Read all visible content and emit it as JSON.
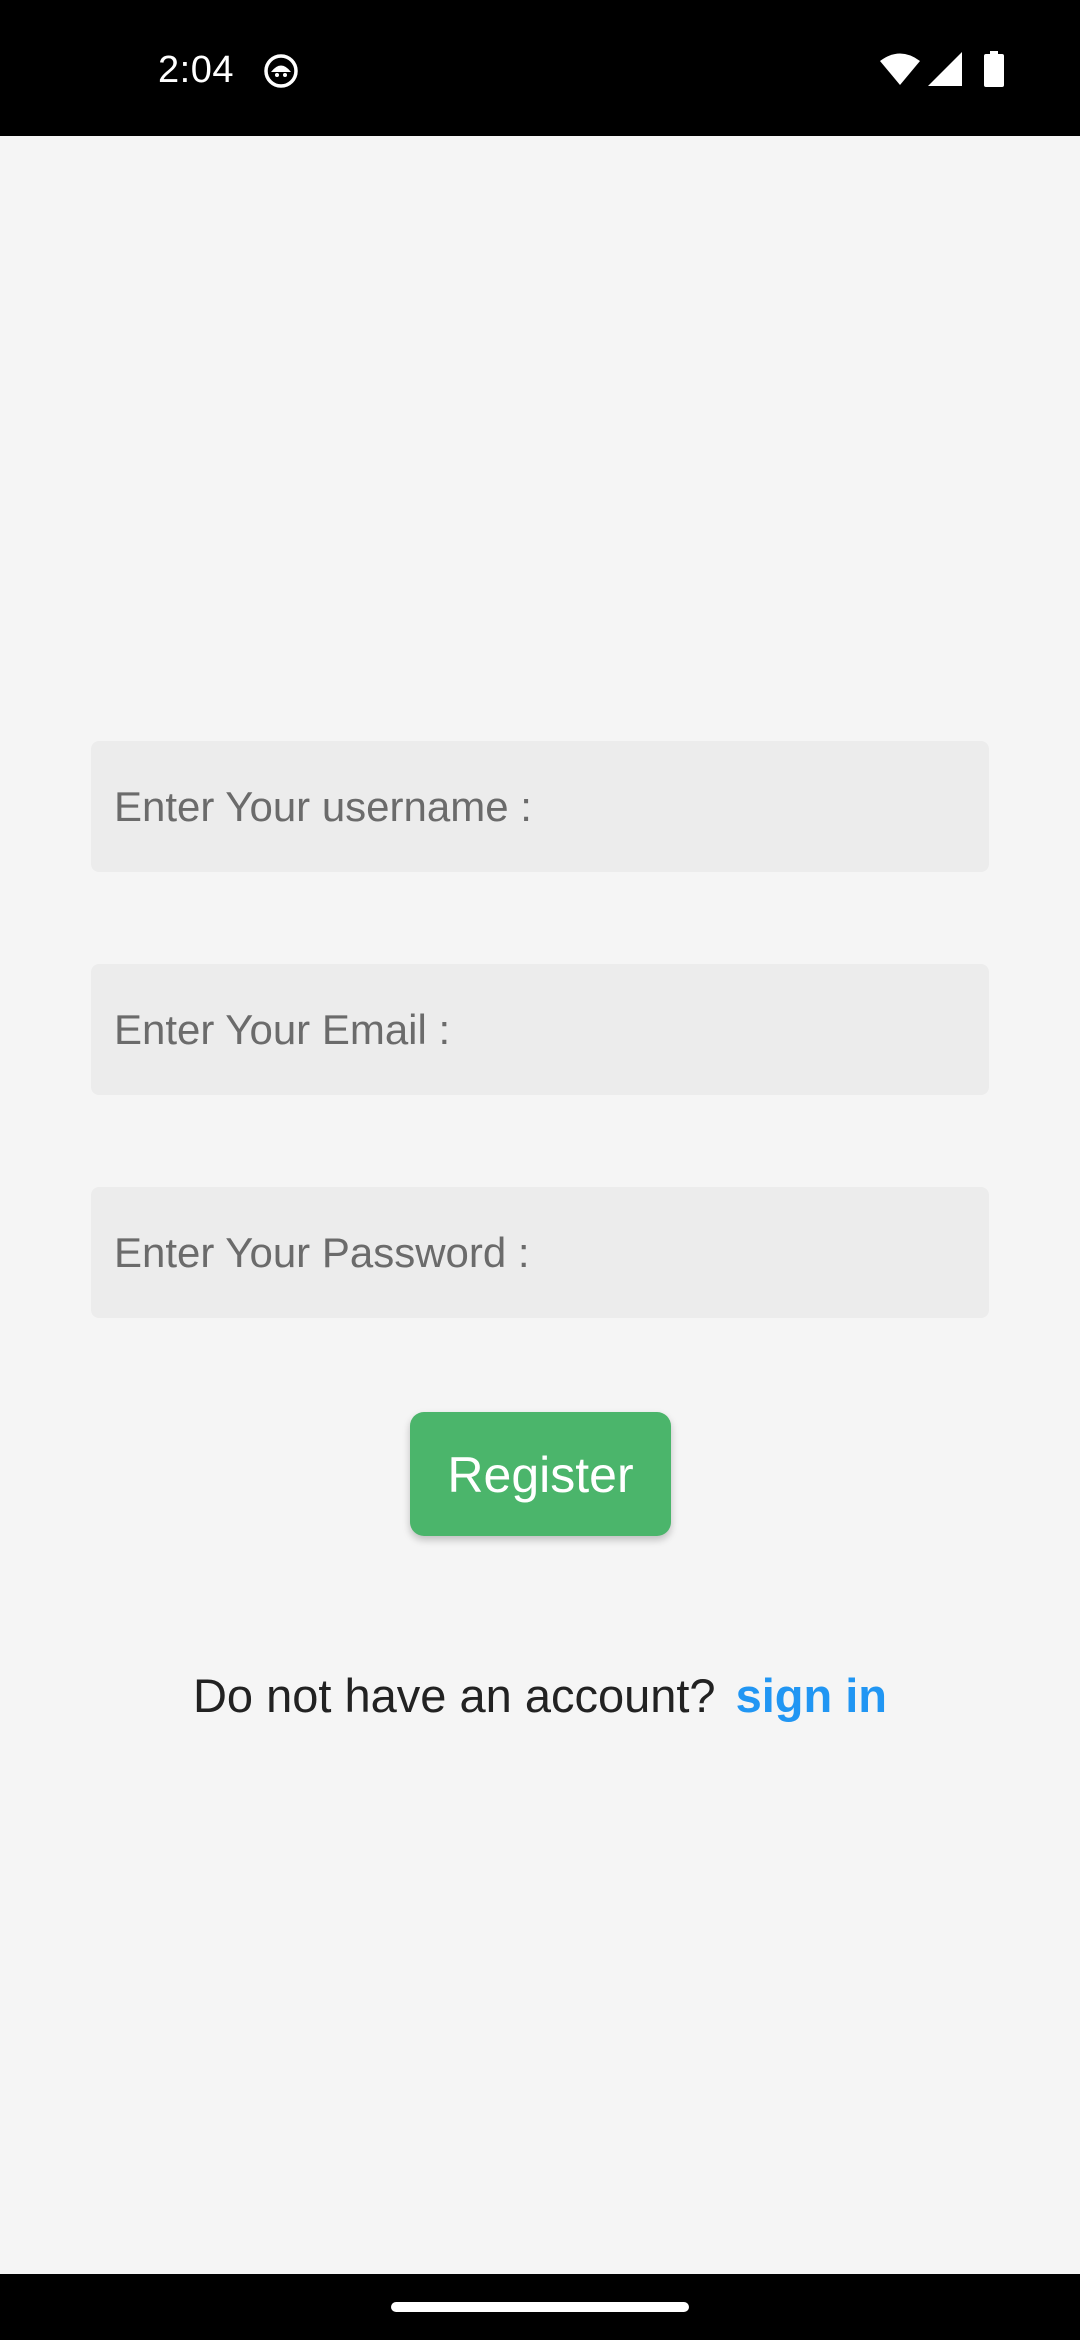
{
  "status_bar": {
    "time": "2:04",
    "notification_icon": "android-debug-icon",
    "icons": [
      "wifi-icon",
      "cell-signal-icon",
      "battery-icon"
    ]
  },
  "form": {
    "username_placeholder": "Enter Your username :",
    "username_value": "",
    "email_placeholder": "Enter Your Email :",
    "email_value": "",
    "password_placeholder": "Enter Your Password :",
    "password_value": "",
    "register_label": "Register"
  },
  "footer": {
    "prompt": "Do not have an account?",
    "link_label": "sign in"
  },
  "colors": {
    "accent_button": "#4bb56b",
    "link": "#2196f3",
    "field_background": "#ececec",
    "page_background": "#f5f5f5"
  }
}
